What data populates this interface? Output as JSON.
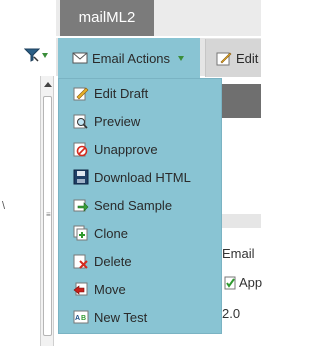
{
  "tab": {
    "label": "mailML2"
  },
  "toolbar": {
    "email_actions_label": "Email Actions",
    "edit_label": "Edit"
  },
  "menu": {
    "items": [
      {
        "label": "Edit Draft",
        "icon": "edit-draft-icon"
      },
      {
        "label": "Preview",
        "icon": "preview-icon"
      },
      {
        "label": "Unapprove",
        "icon": "unapprove-icon"
      },
      {
        "label": "Download HTML",
        "icon": "download-html-icon"
      },
      {
        "label": "Send Sample",
        "icon": "send-sample-icon"
      },
      {
        "label": "Clone",
        "icon": "clone-icon"
      },
      {
        "label": "Delete",
        "icon": "delete-icon"
      },
      {
        "label": "Move",
        "icon": "move-icon"
      },
      {
        "label": "New Test",
        "icon": "new-test-icon"
      }
    ]
  },
  "background": {
    "email_fragment": "Email",
    "app_fragment": "App",
    "version_fragment": "2.0",
    "left_fragment": "\\"
  },
  "colors": {
    "menu_bg": "#89c4d3",
    "tab_bg": "#7b7b7b",
    "toolbar_bg": "#e5e5e5",
    "accent_green": "#3a8d3a"
  }
}
